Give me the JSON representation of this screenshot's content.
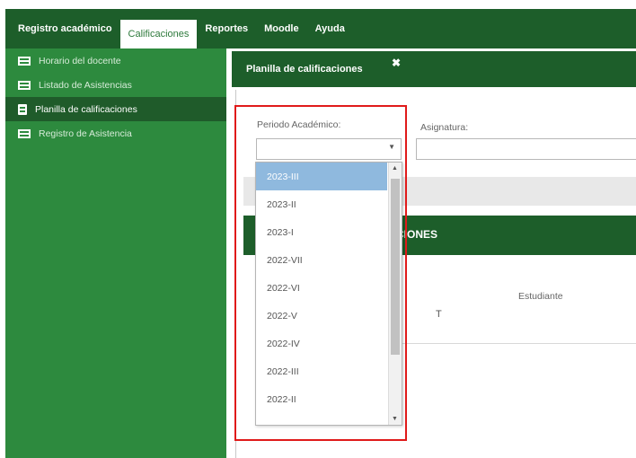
{
  "menubar": {
    "items": [
      {
        "label": "Registro académico"
      },
      {
        "label": "Calificaciones"
      },
      {
        "label": "Reportes"
      },
      {
        "label": "Moodle"
      },
      {
        "label": "Ayuda"
      }
    ],
    "active_index": 1
  },
  "sidebar": {
    "items": [
      {
        "label": "Horario del docente",
        "icon": "table-icon"
      },
      {
        "label": "Listado de Asistencias",
        "icon": "table-icon"
      },
      {
        "label": "Planilla de calificaciones",
        "icon": "document-icon"
      },
      {
        "label": "Registro de Asistencia",
        "icon": "table-icon"
      }
    ],
    "active_index": 2
  },
  "tab": {
    "label": "Planilla de calificaciones",
    "close_glyph": "✖"
  },
  "form": {
    "period_label": "Periodo Académico:",
    "period_value": "",
    "subject_label": "Asignatura:",
    "subject_value": ""
  },
  "section": {
    "title": "CIONES"
  },
  "table": {
    "col_t": "T",
    "col_student": "Estudiante"
  },
  "dropdown": {
    "options": [
      "2023-III",
      "2023-II",
      "2023-I",
      "2022-VII",
      "2022-VI",
      "2022-V",
      "2022-IV",
      "2022-III",
      "2022-II"
    ],
    "selected_index": 0
  },
  "colors": {
    "dark_green": "#1d5e2a",
    "sidebar_green": "#2d8a3e",
    "selected_blue": "#8fb9de",
    "highlight_red": "#e01a1a"
  }
}
